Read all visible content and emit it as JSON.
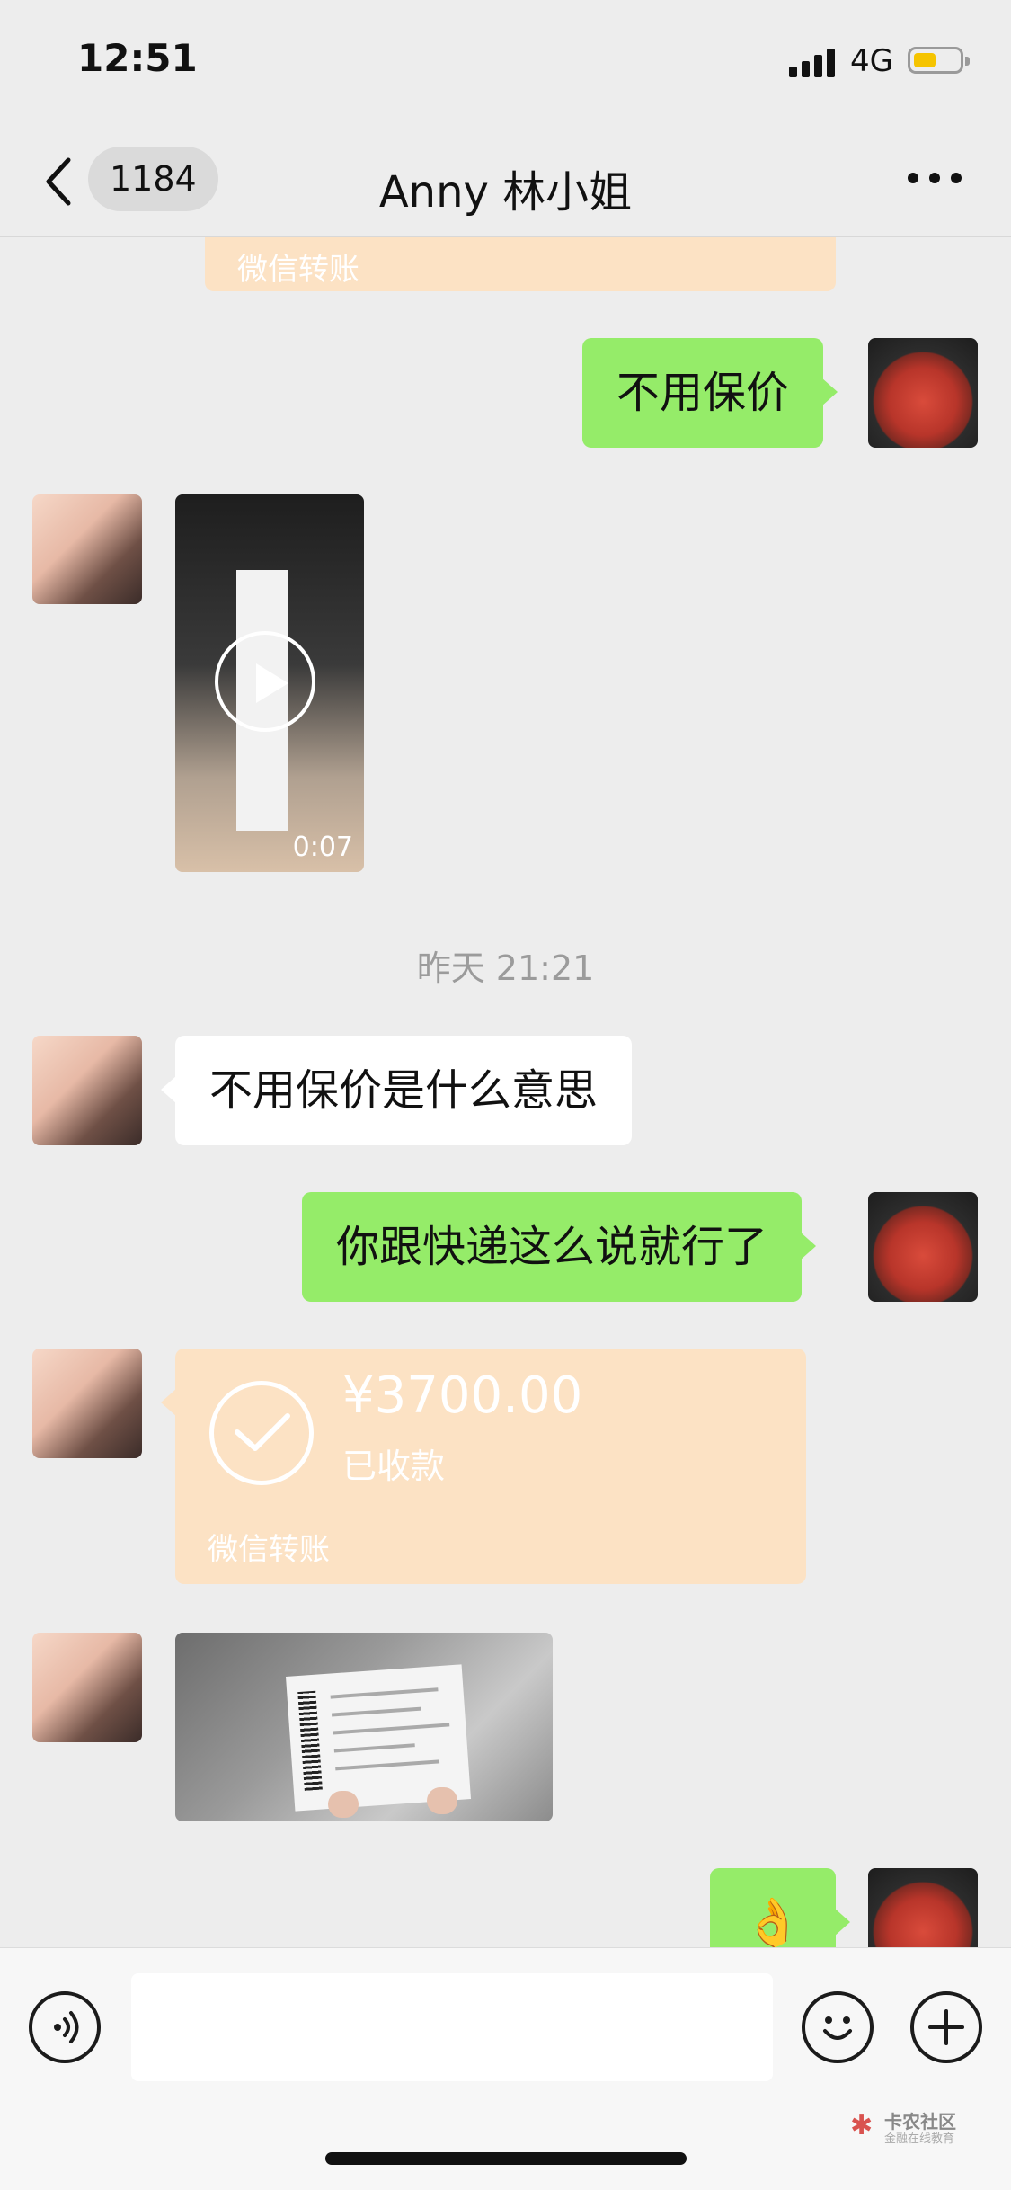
{
  "status_bar": {
    "time": "12:51",
    "network": "4G",
    "battery_level": 0.45
  },
  "nav": {
    "unread_count": "1184",
    "title": "Anny 林小姐"
  },
  "messages": {
    "partial_transfer_label": "微信转账",
    "msg_1": "不用保价",
    "video_duration": "0:07",
    "timestamp": "昨天 21:21",
    "msg_2": "不用保价是什么意思",
    "msg_3": "你跟快递这么说就行了",
    "transfer": {
      "amount": "¥3700.00",
      "status": "已收款",
      "label": "微信转账"
    },
    "msg_4_emoji": "👌"
  },
  "watermark": {
    "title": "卡农社区",
    "subtitle": "金融在线教育"
  },
  "colors": {
    "my_bubble": "#95ec69",
    "their_bubble": "#ffffff",
    "transfer": "#fce2c4",
    "background": "#ededed"
  }
}
